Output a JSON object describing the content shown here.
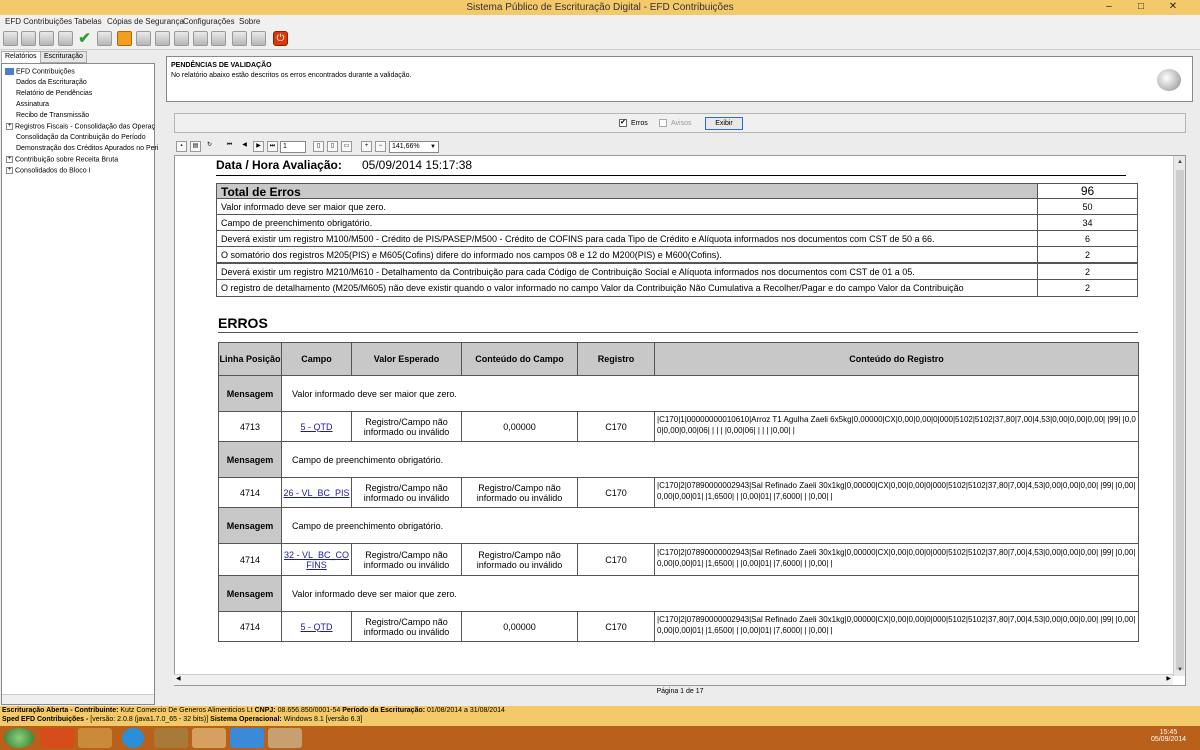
{
  "window": {
    "title": "Sistema Público de Escrituração Digital - EFD Contribuições"
  },
  "menu": [
    "EFD Contribuições",
    "Tabelas",
    "Cópias de Segurança",
    "Configurações",
    "Sobre"
  ],
  "left_tabs": [
    "Relatórios",
    "Escrituração"
  ],
  "tree": [
    {
      "label": "EFD Contribuições",
      "expander": ""
    },
    {
      "label": "Dados da Escrituração",
      "expander": ""
    },
    {
      "label": "Relatório de Pendências",
      "expander": ""
    },
    {
      "label": "Assinatura",
      "expander": ""
    },
    {
      "label": "Recibo de Transmissão",
      "expander": ""
    },
    {
      "label": "Registros Fiscais - Consolidação das Operaç",
      "expander": "+"
    },
    {
      "label": "Consolidação da Contribuição do Período",
      "expander": ""
    },
    {
      "label": "Demonstração dos Créditos Apurados no Peri",
      "expander": ""
    },
    {
      "label": "Contribuição sobre Receita Bruta",
      "expander": "+"
    },
    {
      "label": "Consolidados do Bloco I",
      "expander": "+"
    }
  ],
  "panel": {
    "title": "PENDÊNCIAS DE VALIDAÇÃO",
    "desc": "No relatório abaixo estão descritos os erros encontrados durante a validação."
  },
  "filter": {
    "erros_label": "Erros",
    "avisos_label": "Avisos",
    "exibir_label": "Exibir",
    "erros_checked": "✔"
  },
  "report_toolbar": {
    "page_input": "1",
    "zoom": "141,66%"
  },
  "report": {
    "data_hora_label": "Data / Hora Avaliação:",
    "data_hora_value": "05/09/2014 15:17:38",
    "total_label": "Total de Erros",
    "total_value": "96",
    "summary": [
      {
        "desc": "Valor informado deve ser maior que zero.",
        "count": "50"
      },
      {
        "desc": "Campo de preenchimento obrigatório.",
        "count": "34"
      },
      {
        "desc": "Deverá existir um registro M100/M500 - Crédito de PIS/PASEP/M500 - Crédito de COFINS para cada Tipo de Crédito e Alíquota informados nos documentos com CST de 50 a 66.",
        "count": "6"
      },
      {
        "desc": "O somatório dos registros M205(PIS) e M605(Cofins) difere do informado nos campos 08 e 12 do M200(PIS) e M600(Cofins).",
        "count": "2"
      },
      {
        "desc": "Deverá existir um registro M210/M610 - Detalhamento da Contribuição para cada Código de Contribuição Social e Alíquota informados nos documentos com CST de 01 a 05.",
        "count": "2"
      },
      {
        "desc": "O registro de detalhamento (M205/M605) não deve existir quando o valor informado no campo Valor da Contribuição Não Cumulativa a Recolher/Pagar e do campo Valor da Contribuição",
        "count": "2"
      }
    ],
    "erros_heading": "ERROS",
    "columns": [
      "Linha Posição",
      "Campo",
      "Valor Esperado",
      "Conteúdo do Campo",
      "Registro",
      "Conteúdo do Registro"
    ],
    "message_label": "Mensagem",
    "blocks": [
      {
        "message": "Valor informado deve ser maior que zero.",
        "linha": "4713",
        "campo": "5 - QTD",
        "valor_esperado": "Registro/Campo não informado ou inválido",
        "conteudo_campo": "0,00000",
        "registro": "C170",
        "conteudo_registro": "|C170|1|00000000010610|Arroz T1 Agulha Zaeli 6x5kg|0,00000|CX|0,00|0,00|0|000|5102|5102|37,80|7,00|4,53|0,00|0,00|0,00| |99| |0,00|0,00|0,00|06| | | | |0,00|06| | | | |0,00| |"
      },
      {
        "message": "Campo de preenchimento obrigatório.",
        "linha": "4714",
        "campo": "26 - VL_BC_PIS",
        "valor_esperado": "Registro/Campo não informado ou inválido",
        "conteudo_campo": "Registro/Campo não informado ou inválido",
        "registro": "C170",
        "conteudo_registro": "|C170|2|07890000002943|Sal Refinado Zaeli 30x1kg|0,00000|CX|0,00|0,00|0|000|5102|5102|37,80|7,00|4,53|0,00|0,00|0,00| |99| |0,00|0,00|0,00|01| |1,6500| | |0,00|01| |7,6000| | |0,00| |"
      },
      {
        "message": "Campo de preenchimento obrigatório.",
        "linha": "4714",
        "campo": "32 - VL_BC_COFINS",
        "valor_esperado": "Registro/Campo não informado ou inválido",
        "conteudo_campo": "Registro/Campo não informado ou inválido",
        "registro": "C170",
        "conteudo_registro": "|C170|2|07890000002943|Sal Refinado Zaeli 30x1kg|0,00000|CX|0,00|0,00|0|000|5102|5102|37,80|7,00|4,53|0,00|0,00|0,00| |99| |0,00|0,00|0,00|01| |1,6500| | |0,00|01| |7,6000| | |0,00| |"
      },
      {
        "message": "Valor informado deve ser maior que zero.",
        "linha": "4714",
        "campo": "5 - QTD",
        "valor_esperado": "Registro/Campo não informado ou inválido",
        "conteudo_campo": "0,00000",
        "registro": "C170",
        "conteudo_registro": "|C170|2|07890000002943|Sal Refinado Zaeli 30x1kg|0,00000|CX|0,00|0,00|0|000|5102|5102|37,80|7,00|4,53|0,00|0,00|0,00| |99| |0,00|0,00|0,00|01| |1,6500| | |0,00|01| |7,6000| | |0,00| |"
      }
    ]
  },
  "pager": "Página 1 de 17",
  "status": {
    "line1_label": "Escrituração Aberta - Contribuinte:",
    "line1_contrib": "Kutz Comercio De Generos Alimenticios Lt",
    "cnpj_label": "CNPJ:",
    "cnpj": "08.656.850/0001-54",
    "periodo_label": "Período da Escrituração:",
    "periodo": "01/08/2014 a 31/08/2014",
    "line2_label": "Sped EFD Contribuições -",
    "versao": "[versão: 2.0.8 (java1.7.0_65 - 32 bits)]",
    "so_label": "Sistema Operacional:",
    "so": "Windows 8.1 [versão 6.3]"
  },
  "taskbar": {
    "time": "15:45",
    "date": "05/09/2014"
  },
  "colors": {
    "title_bar": "#f4c96a",
    "taskbar": "#b9601a",
    "table_header": "#c8c8c8",
    "link": "#1a1aa8"
  }
}
